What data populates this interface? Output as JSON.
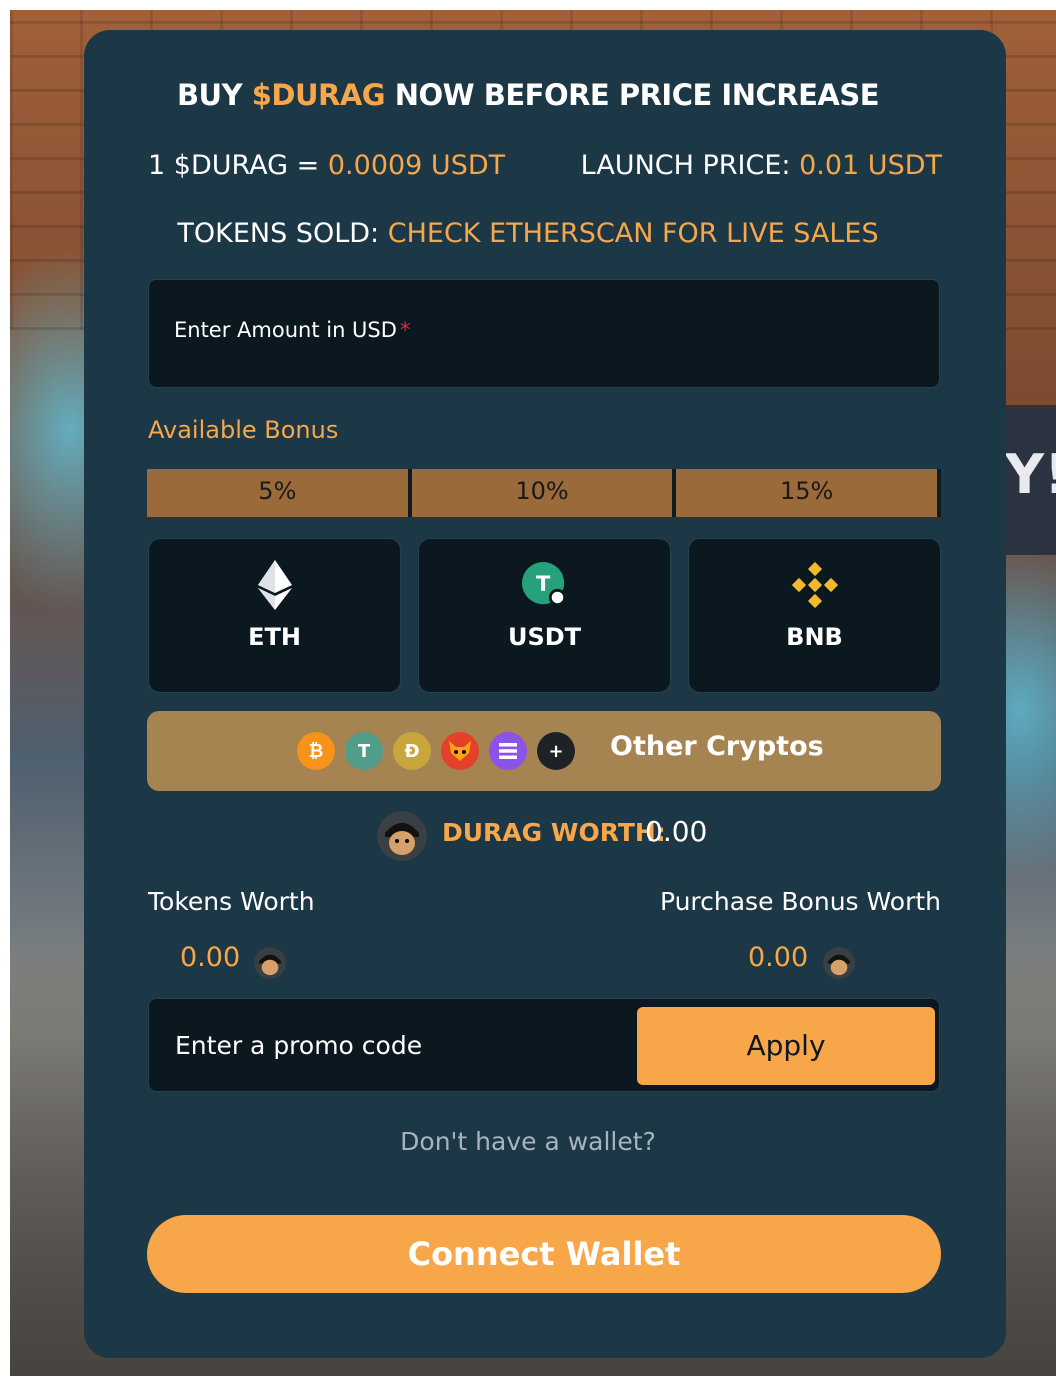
{
  "header": {
    "headline_prefix": "BUY",
    "headline_token": "$DURAG",
    "headline_suffix": "NOW BEFORE PRICE INCREASE"
  },
  "price": {
    "rate_label": "1 $DURAG =",
    "rate_value": "0.0009 USDT",
    "launch_label": "LAUNCH PRICE:",
    "launch_value": "0.01 USDT",
    "sold_label": "TOKENS SOLD:",
    "sold_value": "CHECK ETHERSCAN FOR LIVE SALES"
  },
  "amount": {
    "label": "Enter Amount in USD",
    "required_mark": "*"
  },
  "bonus": {
    "title": "Available Bonus",
    "tiers": [
      "5%",
      "10%",
      "15%"
    ]
  },
  "currencies": [
    {
      "label": "ETH",
      "icon": "ethereum-icon"
    },
    {
      "label": "USDT",
      "icon": "tether-icon"
    },
    {
      "label": "BNB",
      "icon": "binance-icon"
    }
  ],
  "other_cryptos": {
    "label": "Other Cryptos",
    "icons": [
      "bitcoin-icon",
      "tron-usdt-icon",
      "dogecoin-icon",
      "shiba-inu-icon",
      "solana-icon",
      "plus-icon"
    ]
  },
  "worth": {
    "title": "DURAG WORTH:",
    "value": "0.00"
  },
  "tokens": {
    "label": "Tokens Worth",
    "value": "0.00"
  },
  "purchase_bonus": {
    "label": "Purchase Bonus Worth",
    "value": "0.00"
  },
  "promo": {
    "placeholder": "Enter a promo code",
    "apply_label": "Apply"
  },
  "footer": {
    "no_wallet": "Don't have a wallet?",
    "connect_label": "Connect Wallet"
  },
  "colors": {
    "accent": "#f7a74a",
    "card": "#1c3746",
    "field": "#0b181f",
    "bonus_bar": "#9a6a3a",
    "other_button": "#a68452"
  }
}
